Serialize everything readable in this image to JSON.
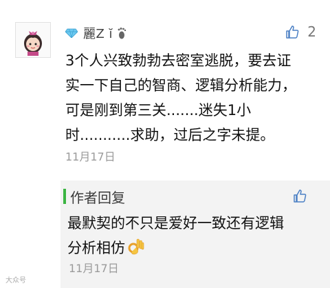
{
  "comment": {
    "username": "麗Z ĭ",
    "likes": "2",
    "text_lines": [
      "3个人兴致勃勃去密室逃脱，要去证",
      "实一下自己的智商、逻辑分析能力，",
      "可是刚到第三关.......迷失1小",
      "时...........求助，过后之字未提。"
    ],
    "date": "11月17日"
  },
  "reply": {
    "label": "作者回复",
    "text_lines": [
      "最默契的不只是爱好一致还有逻辑",
      "分析相仿"
    ],
    "date": "11月17日"
  },
  "watermark": "大众号"
}
